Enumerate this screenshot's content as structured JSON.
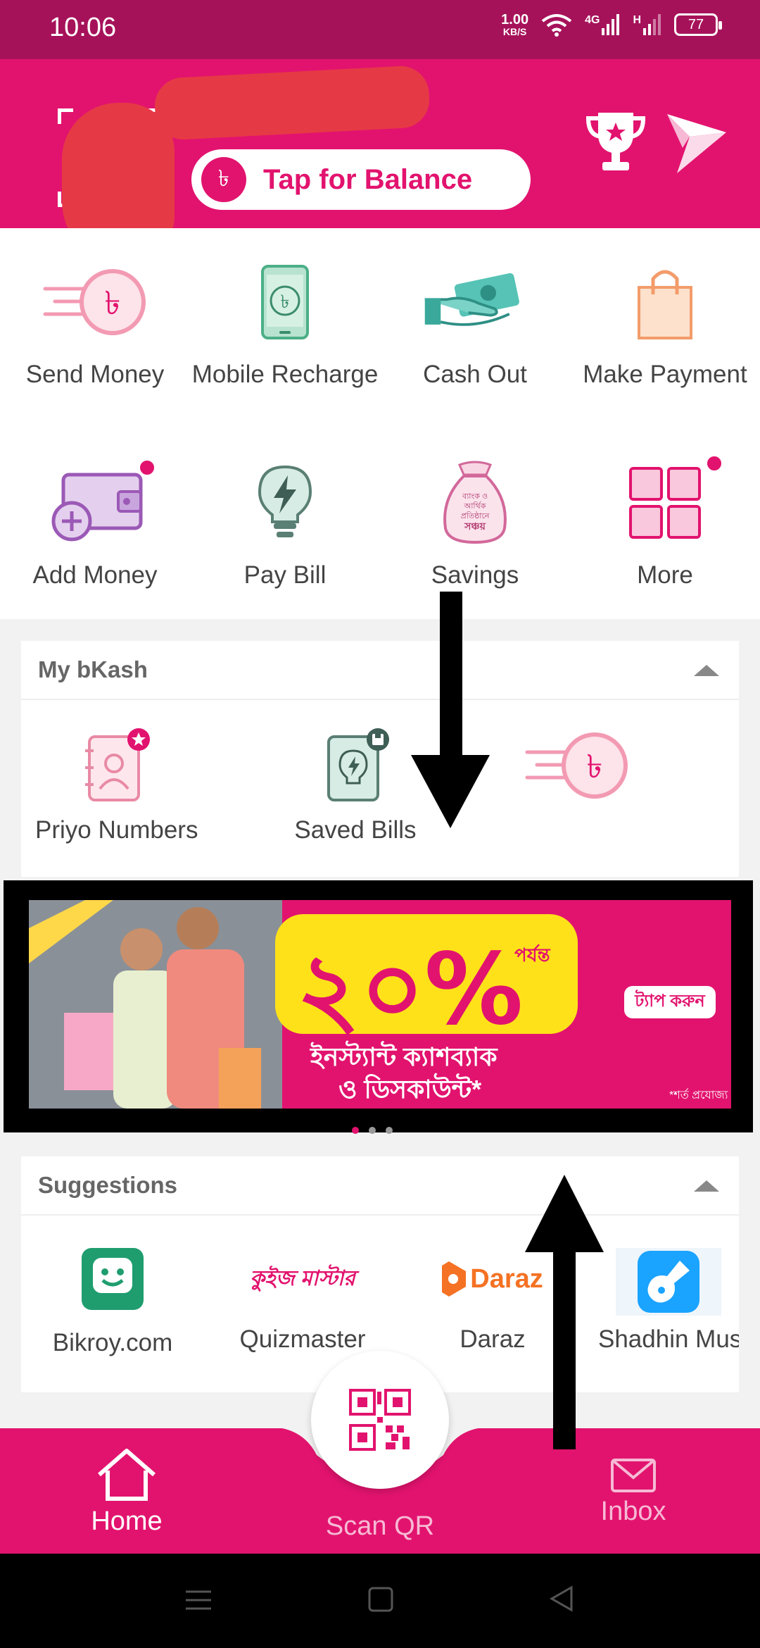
{
  "status_bar": {
    "time": "10:06",
    "speed_value": "1.00",
    "speed_unit": "KB/S",
    "network_4g": "4G",
    "network_h": "H",
    "battery": "77"
  },
  "header": {
    "balance_label": "Tap for Balance",
    "taka_symbol": "৳"
  },
  "quick_actions": [
    {
      "label": "Send Money",
      "icon": "send-money-icon"
    },
    {
      "label": "Mobile Recharge",
      "icon": "mobile-recharge-icon"
    },
    {
      "label": "Cash Out",
      "icon": "cash-out-icon"
    },
    {
      "label": "Make Payment",
      "icon": "shopping-bag-icon"
    },
    {
      "label": "Add Money",
      "icon": "wallet-add-icon"
    },
    {
      "label": "Pay Bill",
      "icon": "bulb-icon"
    },
    {
      "label": "Savings",
      "icon": "savings-bag-icon"
    },
    {
      "label": "More",
      "icon": "grid-icon"
    }
  ],
  "savings_icon_text": [
    "ব্যাংক ও",
    "আর্থিক",
    "প্রতিষ্ঠানে",
    "সঞ্চয়"
  ],
  "my_bkash": {
    "title": "My bKash",
    "items": [
      {
        "label": "Priyo Numbers",
        "icon": "contact-star-icon"
      },
      {
        "label": "Saved Bills",
        "icon": "saved-bill-icon"
      },
      {
        "label": "",
        "icon": "send-money-icon"
      }
    ]
  },
  "banner": {
    "headline": "২০%",
    "upto": "পর্যন্ত",
    "line1": "ইনস্ট্যান্ট ক্যাশব্যাক",
    "line2": "ও ডিসকাউন্ট*",
    "tap_label": "ট্যাপ করুন",
    "terms": "*শর্ত প্রযোজ্য"
  },
  "suggestions": {
    "title": "Suggestions",
    "items": [
      {
        "label": "Bikroy.com",
        "icon": "bikroy-icon"
      },
      {
        "label": "Quizmaster",
        "icon": "quizmaster-logo",
        "logo_text": "কুইজ মাস্টার"
      },
      {
        "label": "Daraz",
        "icon": "daraz-logo",
        "logo_text": "Daraz"
      },
      {
        "label": "Shadhin Music",
        "icon": "guitar-icon"
      }
    ]
  },
  "bottom_nav": {
    "home": "Home",
    "scan": "Scan QR",
    "inbox": "Inbox"
  },
  "colors": {
    "brand": "#e2136e",
    "status_bar": "#a6125a",
    "redaction": "#e63946",
    "banner_yellow": "#ffe11a",
    "bikroy_green": "#1f9d6f",
    "daraz_orange": "#f57224",
    "shadhin_blue": "#1aa3ff"
  }
}
